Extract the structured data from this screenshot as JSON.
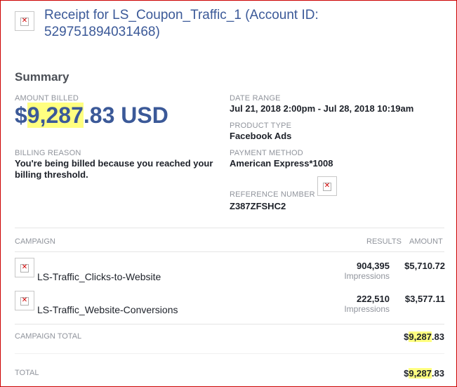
{
  "header": {
    "title": "Receipt for LS_Coupon_Traffic_1 (Account ID: 529751894031468)",
    "logo_icon": "broken-image-icon"
  },
  "summary": {
    "heading": "Summary",
    "amount_billed_label": "AMOUNT BILLED",
    "amount_currency_symbol": "$",
    "amount_whole": "9,287",
    "amount_fraction": ".83 USD",
    "billing_reason_label": "BILLING REASON",
    "billing_reason": "You're being billed because you reached your billing threshold.",
    "date_range_label": "DATE RANGE",
    "date_range": "Jul 21, 2018 2:00pm - Jul 28, 2018 10:19am",
    "product_type_label": "PRODUCT TYPE",
    "product_type": "Facebook Ads",
    "payment_method_label": "PAYMENT METHOD",
    "payment_method": "American Express*1008",
    "reference_number_label": "REFERENCE NUMBER",
    "reference_number": "Z387ZFSHC2"
  },
  "table": {
    "col_campaign": "CAMPAIGN",
    "col_results": "RESULTS",
    "col_amount": "AMOUNT",
    "rows": [
      {
        "name": "LS-Traffic_Clicks-to-Website",
        "results": "904,395",
        "results_unit": "Impressions",
        "amount": "$5,710.72"
      },
      {
        "name": "LS-Traffic_Website-Conversions",
        "results": "222,510",
        "results_unit": "Impressions",
        "amount": "$3,577.11"
      }
    ]
  },
  "totals": {
    "campaign_total_label": "CAMPAIGN TOTAL",
    "campaign_total_prefix": "$",
    "campaign_total_whole": "9,287",
    "campaign_total_fraction": ".83",
    "total_label": "TOTAL",
    "total_prefix": "$",
    "total_whole": "9,287",
    "total_fraction": ".83"
  },
  "colors": {
    "brand_blue": "#3b5998",
    "highlight": "#ffff80",
    "frame_border": "#cc0000"
  }
}
